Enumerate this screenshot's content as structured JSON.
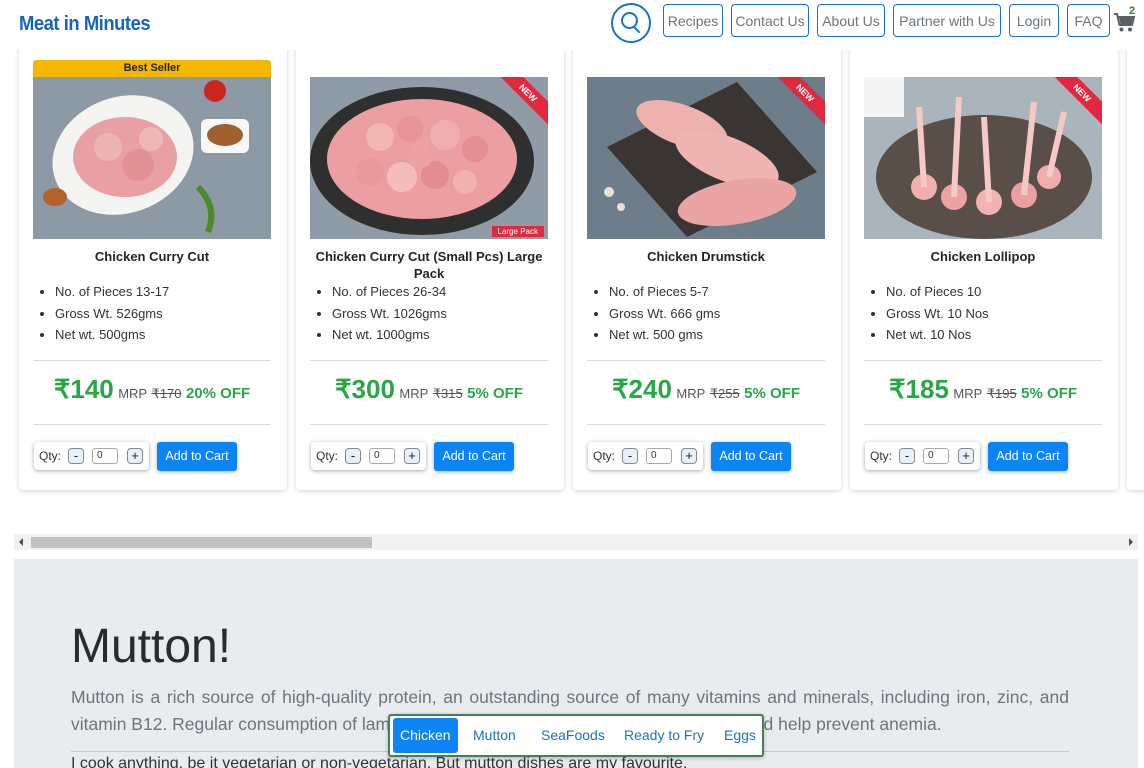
{
  "header": {
    "logo": "Meat in Minutes",
    "nav": [
      "Recipes",
      "Contact Us",
      "About Us",
      "Partner with Us",
      "Login",
      "FAQ"
    ],
    "cart_count": "2"
  },
  "products": [
    {
      "name": "Chicken Curry Cut",
      "badge": "Best Seller",
      "ribbon": "",
      "tag": "",
      "specs": [
        "No. of Pieces 13-17",
        "Gross Wt. 526gms",
        "Net wt. 500gms"
      ],
      "price": "₹140",
      "mrp_label": "MRP",
      "mrp": "₹170",
      "off": "20% OFF",
      "qty_label": "Qty:",
      "qty": "0",
      "add_label": "Add to Cart"
    },
    {
      "name": "Chicken Curry Cut (Small Pcs) Large Pack",
      "badge": "",
      "ribbon": "NEW",
      "tag": "Large Pack",
      "specs": [
        "No. of Pieces 26-34",
        "Gross Wt. 1026gms",
        "Net wt. 1000gms"
      ],
      "price": "₹300",
      "mrp_label": "MRP",
      "mrp": "₹315",
      "off": "5% OFF",
      "qty_label": "Qty:",
      "qty": "0",
      "add_label": "Add to Cart"
    },
    {
      "name": "Chicken Drumstick",
      "badge": "",
      "ribbon": "NEW",
      "tag": "",
      "specs": [
        "No. of Pieces 5-7",
        "Gross Wt. 666 gms",
        "Net wt. 500 gms"
      ],
      "price": "₹240",
      "mrp_label": "MRP",
      "mrp": "₹255",
      "off": "5% OFF",
      "qty_label": "Qty:",
      "qty": "0",
      "add_label": "Add to Cart"
    },
    {
      "name": "Chicken Lollipop",
      "badge": "",
      "ribbon": "NEW",
      "tag": "",
      "specs": [
        "No. of Pieces 10",
        "Gross Wt. 10 Nos",
        "Net wt. 10 Nos"
      ],
      "price": "₹185",
      "mrp_label": "MRP",
      "mrp": "₹195",
      "off": "5% OFF",
      "qty_label": "Qty:",
      "qty": "0",
      "add_label": "Add to Cart"
    }
  ],
  "mutton": {
    "title": "Mutton!",
    "description": "Mutton is a rich source of high-quality protein, an outstanding source of many vitamins and minerals, including iron, zinc, and vitamin B12. Regular consumption of lamb may promote muscle growth, maintenance, and help prevent anemia.",
    "quote": "I cook anything, be it vegetarian or non-vegetarian. But mutton dishes are my favourite."
  },
  "category_nav": {
    "items": [
      "Chicken",
      "Mutton",
      "SeaFoods",
      "Ready to Fry",
      "Eggs"
    ],
    "active": "Chicken"
  },
  "colors": {
    "brand": "#1565c0",
    "accent": "#0d84f5",
    "price_green": "#28a745",
    "badge_yellow": "#f5b800",
    "ribbon_red": "#e0283f"
  }
}
